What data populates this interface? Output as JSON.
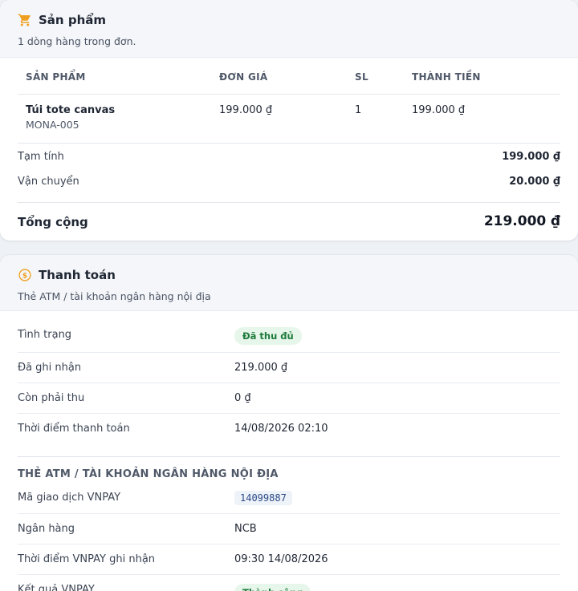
{
  "products": {
    "title": "Sản phẩm",
    "subtitle": "1 dòng hàng trong đơn.",
    "icon": "cart-icon",
    "columns": [
      "SẢN PHẨM",
      "ĐƠN GIÁ",
      "SL",
      "THÀNH TIỀN"
    ],
    "items": [
      {
        "name": "Túi tote canvas",
        "sku": "MONA-005",
        "price": "199.000 ₫",
        "qty": "1",
        "total": "199.000 ₫"
      }
    ],
    "summary": {
      "subtotal_label": "Tạm tính",
      "subtotal": "199.000 ₫",
      "shipping_label": "Vận chuyển",
      "shipping": "20.000 ₫",
      "total_label": "Tổng cộng",
      "total": "219.000 ₫"
    }
  },
  "payment": {
    "title": "Thanh toán",
    "subtitle": "Thẻ ATM / tài khoản ngân hàng nội địa",
    "icon": "dollar-coin-icon",
    "rows": [
      {
        "label": "Tình trạng",
        "value": "Đã thu đủ"
      },
      {
        "label": "Đã ghi nhận",
        "value": "219.000 ₫"
      },
      {
        "label": "Còn phải thu",
        "value": "0 ₫"
      },
      {
        "label": "Thời điểm thanh toán",
        "value": "14/08/2026 02:10"
      }
    ],
    "gateway": {
      "title": "THẺ ATM / TÀI KHOẢN NGÂN HÀNG NỘI ĐỊA",
      "rows": [
        {
          "label": "Mã giao dịch VNPAY",
          "value": "14099887"
        },
        {
          "label": "Ngân hàng",
          "value": "NCB"
        },
        {
          "label": "Thời điểm VNPAY ghi nhận",
          "value": "09:30 14/08/2026"
        },
        {
          "label": "Kết quả VNPAY",
          "value": "Thành công"
        }
      ]
    }
  },
  "colors": {
    "accent_orange": "#f0a020",
    "success_bg": "#e6f6ea",
    "success_text": "#1d7a3a"
  }
}
